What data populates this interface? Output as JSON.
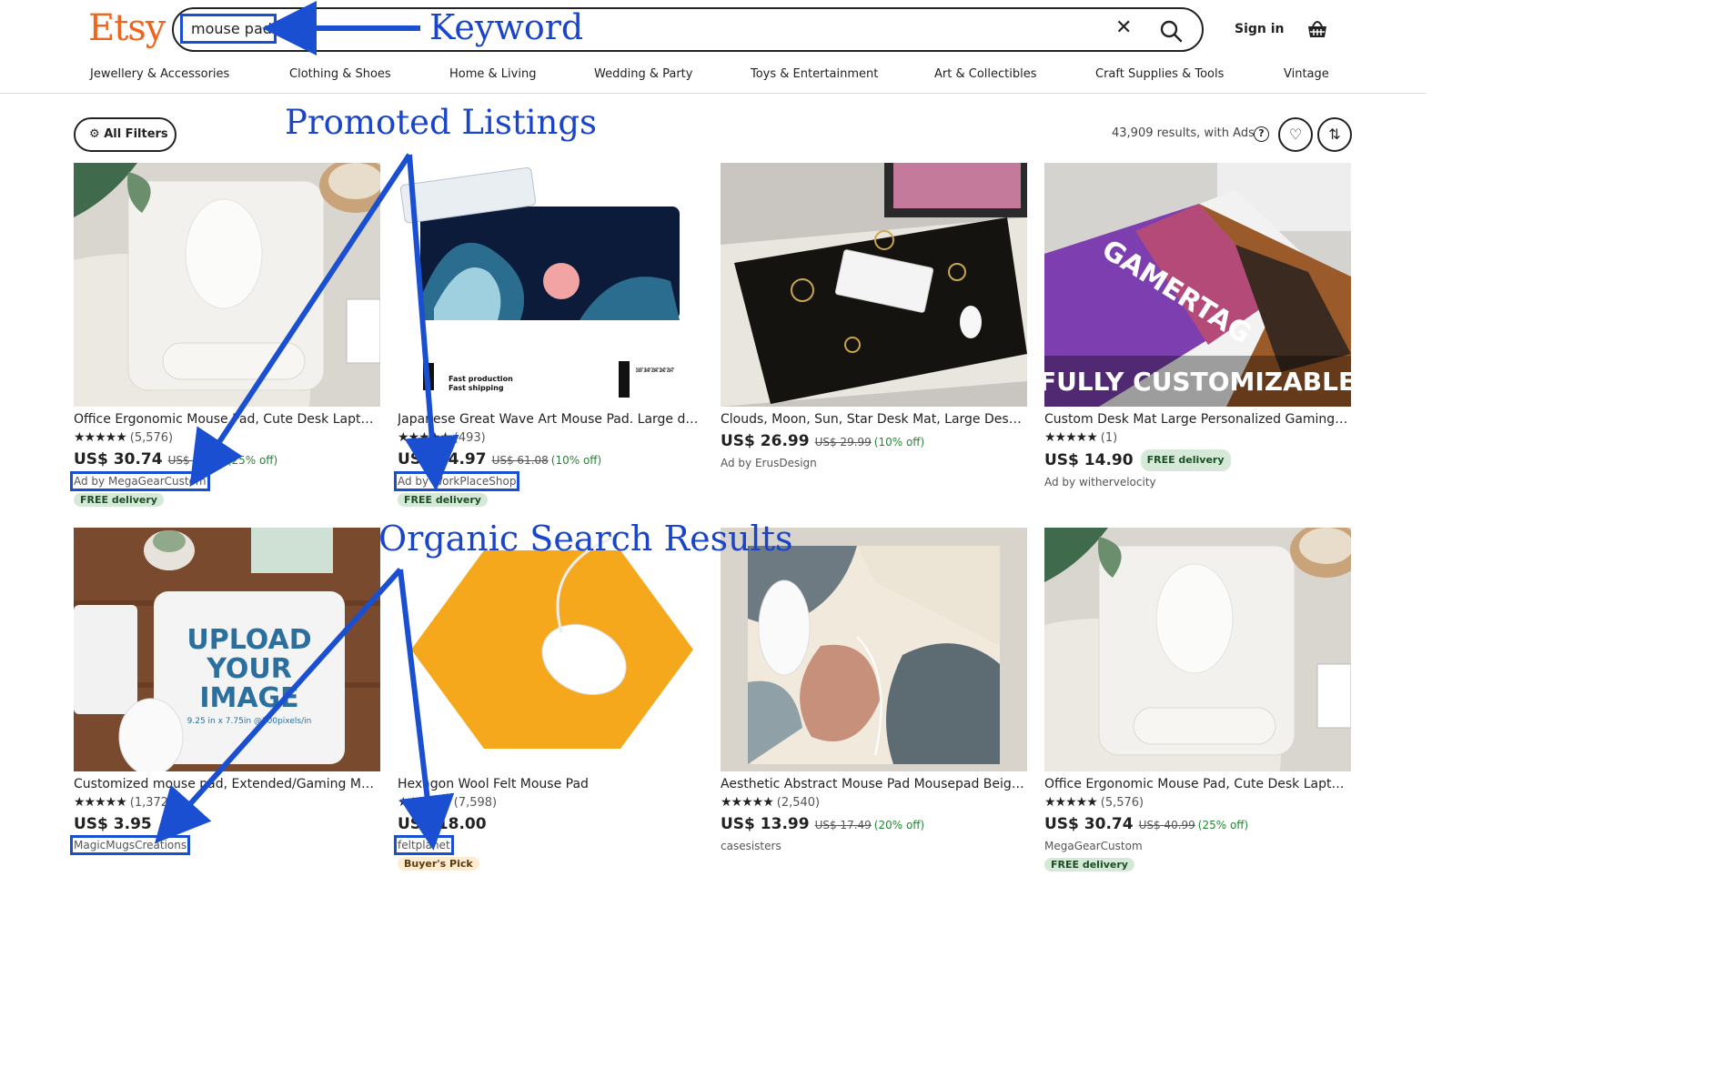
{
  "header": {
    "logo": "Etsy",
    "search_value": "mouse pad",
    "signin": "Sign in"
  },
  "categories": [
    "Jewellery & Accessories",
    "Clothing & Shoes",
    "Home & Living",
    "Wedding & Party",
    "Toys & Entertainment",
    "Art & Collectibles",
    "Craft Supplies & Tools",
    "Vintage"
  ],
  "toolbar": {
    "filters_label": "All Filters",
    "results_text": "43,909 results, with Ads",
    "help_symbol": "?"
  },
  "annotations": {
    "keyword": "Keyword",
    "promoted": "Promoted Listings",
    "organic": "Organic Search Results"
  },
  "listings": [
    {
      "title": "Office Ergonomic Mouse Pad, Cute Desk Laptop Mat",
      "stars": "★★★★★",
      "reviews": "(5,576)",
      "price": "US$ 30.74",
      "original_price": "US$ 40.99",
      "discount": "(25% off)",
      "seller": "Ad by MegaGearCustom",
      "badge": "FREE delivery"
    },
    {
      "title": "Japanese Great Wave Art Mouse Pad. Large desk mat",
      "stars": "★★★★★",
      "reviews": "(493)",
      "price": "US$ 54.97",
      "original_price": "US$ 61.08",
      "discount": "(10% off)",
      "seller": "Ad by WorkPlaceShop",
      "badge": "FREE delivery"
    },
    {
      "title": "Clouds, Moon, Sun, Star Desk Mat, Large Desk Pad",
      "stars": "",
      "reviews": "",
      "price": "US$ 26.99",
      "original_price": "US$ 29.99",
      "discount": "(10% off)",
      "seller": "Ad by ErusDesign",
      "badge": ""
    },
    {
      "title": "Custom Desk Mat Large Personalized Gaming Mouse Pad",
      "stars": "★★★★★",
      "reviews": "(1)",
      "price": "US$ 14.90",
      "original_price": "",
      "discount": "",
      "seller": "Ad by withervelocity",
      "badge": "FREE delivery"
    },
    {
      "title": "Customized mouse pad, Extended/Gaming Mouse Pad",
      "stars": "★★★★★",
      "reviews": "(1,372)",
      "price": "US$ 3.95",
      "original_price": "",
      "discount": "",
      "seller": "MagicMugsCreations",
      "badge": ""
    },
    {
      "title": "Hexagon Wool Felt Mouse Pad",
      "stars": "★★★★★",
      "reviews": "(7,598)",
      "price": "US$ 18.00",
      "original_price": "",
      "discount": "",
      "seller": "feltplanet",
      "badge": "Buyer's Pick"
    },
    {
      "title": "Aesthetic Abstract Mouse Pad Mousepad Beige Boho",
      "stars": "★★★★★",
      "reviews": "(2,540)",
      "price": "US$ 13.99",
      "original_price": "US$ 17.49",
      "discount": "(20% off)",
      "seller": "casesisters",
      "badge": ""
    },
    {
      "title": "Office Ergonomic Mouse Pad, Cute Desk Laptop Mat",
      "stars": "★★★★★",
      "reviews": "(5,576)",
      "price": "US$ 30.74",
      "original_price": "US$ 40.99",
      "discount": "(25% off)",
      "seller": "MegaGearCustom",
      "badge": "FREE delivery"
    }
  ],
  "image_text": {
    "custom_mat_line": "FULLY CUSTOMIZABLE",
    "gamertag": "GAMERTAG",
    "upload_line1": "UPLOAD",
    "upload_line2": "YOUR",
    "upload_line3": "IMAGE",
    "upload_size": "9.25 in x 7.75in @300pixels/in",
    "production": "Fast production",
    "shipping": "Fast shipping",
    "size_options": "16x36\" 16x40\" 20x40\" 20x43\" 20x47\""
  }
}
